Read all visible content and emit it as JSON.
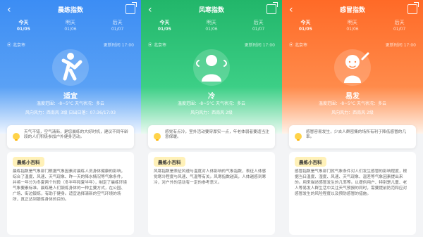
{
  "panels": [
    {
      "theme": "blue",
      "title": "晨练指数",
      "tabs": [
        {
          "label": "今天",
          "date": "01/05",
          "active": true
        },
        {
          "label": "明天",
          "date": "01/06",
          "active": false
        },
        {
          "label": "后天",
          "date": "01/07",
          "active": false
        }
      ],
      "location": "北京市",
      "updated": "更新时间 17:00",
      "level": "适宜",
      "line1": "温度范围：-8~5°C   天气状况：多云",
      "line2": "风向风力：西南风 3级   日出日落：07:36/17:03",
      "tip": "天气不错，空气清新，是您晨练的大好时机，建议不同年龄段的人们积极参加户外健身活动。",
      "wiki_title": "晨练小百科",
      "wiki_text": "晨练指数是气象部门根据气象因素对晨练人员身体健康的影响，综合了温度、风速、天气现象、昨一天的降水情况等气象条件，并将一年分为冬夏两个时段（冬半年和夏半年），制定了晨练环境气象要素标准。晨练是人们锻炼身体的一种主要方式，在公园、广场、街边锻炼，有助于健身。适宜选择清新的空气环境的场所，真正达到锻炼身体的目的。"
    },
    {
      "theme": "green",
      "title": "风寒指数",
      "tabs": [
        {
          "label": "今天",
          "date": "01/05",
          "active": true
        },
        {
          "label": "明天",
          "date": "01/06",
          "active": false
        },
        {
          "label": "后天",
          "date": "01/07",
          "active": false
        }
      ],
      "location": "北京市",
      "updated": "更新时间 17:00",
      "level": "冷",
      "line1": "温度范围：-8~5°C   天气状况：多云",
      "line2": "风向风力：西南风 2级",
      "tip": "感觉有点冷，室外活动要穿厚实一点，年老体弱者要适当注意保暖。",
      "wiki_title": "晨练小百科",
      "wiki_text": "风寒指数是表征风速与温度对人体影响的气象指数，表征人体感觉寒冷程度与风速、气温等有关。风寒指数越高，人体越感到寒冷，对户外的活动有一定的参考意义。"
    },
    {
      "theme": "orange",
      "title": "感冒指数",
      "tabs": [
        {
          "label": "今天",
          "date": "01/05",
          "active": true
        },
        {
          "label": "明天",
          "date": "01/06",
          "active": false
        },
        {
          "label": "后天",
          "date": "01/07",
          "active": false
        }
      ],
      "location": "北京市",
      "updated": "更新时间 17:00",
      "level": "易发",
      "line1": "温度范围：-8~5°C   天气状况：多云",
      "line2": "风向风力：西南风 2级",
      "tip": "感冒容易发生，少去人群密集的场所有利于降低感冒的几率。",
      "wiki_title": "晨练小百科",
      "wiki_text": "感冒指数是气象部门就气象条件对人们发生感冒的影响程度，根据当日温度、湿度、风速、天气现象、温差等气象因素提出来的。用来描述感冒发生的几率等。以提供用户、特别是儿童、老人等易发人群生活中关注天气预报的同时，需要提前防范和应对感冒发生的风险程度以及预防感冒的措施。"
    }
  ],
  "icons": {
    "back": "chevron-left-icon",
    "share": "share-icon",
    "location": "location-pin-icon",
    "tip": "lightbulb-icon"
  },
  "colors": {
    "blue": "#3c8df4",
    "green": "#22b66a",
    "orange": "#ff6a27"
  }
}
